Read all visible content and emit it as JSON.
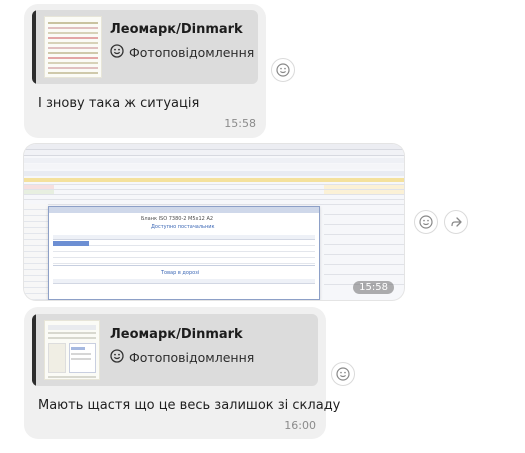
{
  "messages": [
    {
      "reply": {
        "author": "Леомарк/Dinmark",
        "type_label": "Фотоповідомлення"
      },
      "text": "І знову така ж ситуація",
      "time": "15:58"
    },
    {
      "image": {
        "time": "15:58",
        "doc_title": "Бланк ISO 7380-2 M5х12 А2",
        "doc_subtitle": "Доступно постачальник",
        "footer_label": "Товар в дорозі"
      }
    },
    {
      "reply": {
        "author": "Леомарк/Dinmark",
        "type_label": "Фотоповідомлення"
      },
      "text": "Мають щастя що це весь залишок зі складу",
      "time": "16:00"
    }
  ],
  "icons": {
    "photo": "photo-icon",
    "reaction": "smiley-react-icon",
    "forward": "forward-icon"
  },
  "colors": {
    "bubble": "#f0f0f0",
    "reply_card": "#dcdcdc",
    "reply_bar": "#2d2d2d",
    "accent_blue": "#3b67b5"
  }
}
